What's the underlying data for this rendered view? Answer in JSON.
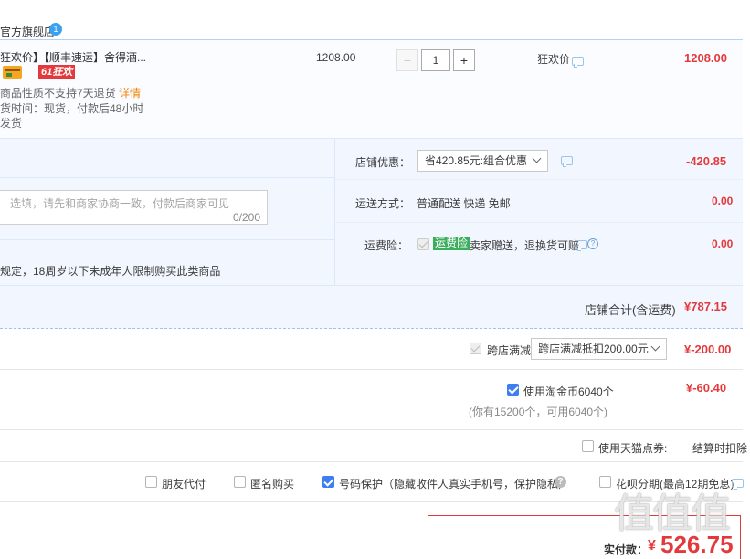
{
  "store": {
    "name": "官方旗舰店",
    "badge": "1"
  },
  "item": {
    "title": "狂欢价】【顺丰速运】舍得酒...",
    "promo_tag": "61狂欢",
    "note_return": "商品性质不支持7天退货",
    "detail_link": "详情",
    "ship_time": "货时间：现货，付款后48小时",
    "ship_time2": "发货",
    "unit_price": "1208.00",
    "quantity": "1",
    "decrease": "−",
    "increase": "+",
    "price_type": "狂欢价",
    "subtotal": "1208.00"
  },
  "store_discount": {
    "label": "店铺优惠：",
    "selected": "省420.85元:组合优惠",
    "amount": "-420.85"
  },
  "shipping": {
    "label": "运送方式：",
    "value": "普通配送 快递 免邮",
    "amount": "0.00"
  },
  "insurance": {
    "label": "运费险：",
    "tag": "运费险",
    "text": "卖家赠送，退换货可赔",
    "amount": "0.00"
  },
  "message": {
    "placeholder": "选填，请先和商家协商一致，付款后商家可见",
    "counter": "0/200"
  },
  "age_notice": "规定，18周岁以下未成年人限制购买此类商品",
  "store_total": {
    "label": "店铺合计(含运费)",
    "amount": "¥787.15"
  },
  "cross_store": {
    "label": "跨店满减",
    "selected": "跨店满减抵扣200.00元",
    "amount": "¥-200.00"
  },
  "taojinbi": {
    "label": "使用淘金币6040个",
    "sub": "(你有15200个，可用6040个)",
    "amount": "¥-60.40"
  },
  "tmall_coupon": {
    "label": "使用天猫点券:",
    "note": "结算时扣除"
  },
  "options": {
    "friend_pay": "朋友代付",
    "anonymous": "匿名购买",
    "number_protect": "号码保护（隐藏收件人真实手机号，保护隐私）",
    "huabei": "花呗分期(最高12期免息)"
  },
  "payment": {
    "label": "实付款：",
    "currency": "¥",
    "amount": "526.75"
  },
  "watermark": "值值值"
}
